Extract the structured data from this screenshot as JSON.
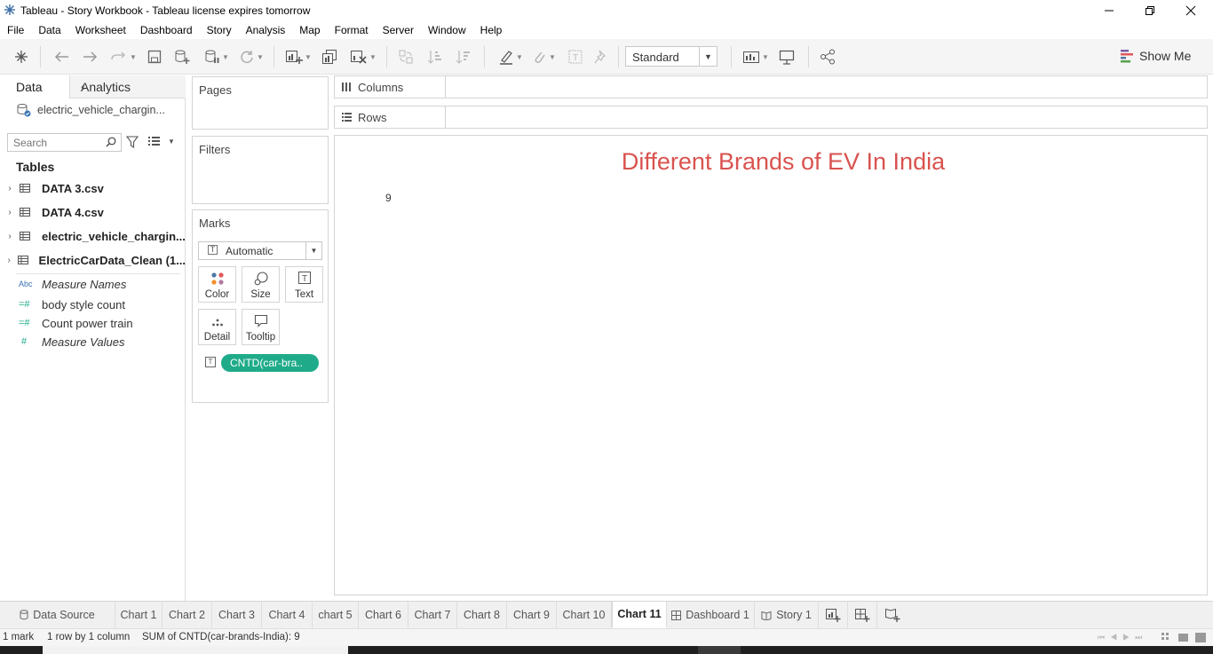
{
  "window": {
    "title": "Tableau - Story Workbook - Tableau license expires tomorrow"
  },
  "menu": [
    "File",
    "Data",
    "Worksheet",
    "Dashboard",
    "Story",
    "Analysis",
    "Map",
    "Format",
    "Server",
    "Window",
    "Help"
  ],
  "toolbar": {
    "fit_value": "Standard",
    "show_me_label": "Show Me"
  },
  "data_pane": {
    "tabs": {
      "data": "Data",
      "analytics": "Analytics"
    },
    "datasource": "electric_vehicle_chargin...",
    "search_placeholder": "Search",
    "tables_heading": "Tables",
    "tables": [
      {
        "label": "DATA 3.csv"
      },
      {
        "label": "DATA 4.csv"
      },
      {
        "label": "electric_vehicle_chargin..."
      },
      {
        "label": "ElectricCarData_Clean (1..."
      }
    ],
    "fields": [
      {
        "label": "Measure Names",
        "icon": "Abc",
        "italic": true
      },
      {
        "label": "body style count",
        "icon": "=#"
      },
      {
        "label": "Count power  train",
        "icon": "=#"
      },
      {
        "label": "Measure Values",
        "icon": "#",
        "italic": true
      }
    ]
  },
  "cards": {
    "pages": "Pages",
    "filters": "Filters",
    "marks": "Marks",
    "mark_type": "Automatic",
    "mark_buttons": {
      "color": "Color",
      "size": "Size",
      "text": "Text",
      "detail": "Detail",
      "tooltip": "Tooltip"
    },
    "pill": "CNTD(car-bra.."
  },
  "shelves": {
    "columns": "Columns",
    "rows": "Rows"
  },
  "view": {
    "title": "Different  Brands of EV In India",
    "value": "9",
    "title_color": "#d9534f"
  },
  "sheet_tabs": {
    "data_source": "Data Source",
    "sheets": [
      "Chart 1",
      "Chart 2",
      "Chart 3",
      "Chart 4",
      "chart 5",
      "Chart 6",
      "Chart 7",
      "Chart 8",
      "Chart 9",
      "Chart 10",
      "Chart 11"
    ],
    "active": "Chart 11",
    "dashboard": "Dashboard 1",
    "story": "Story 1"
  },
  "status": {
    "marks": "1 mark",
    "dims": "1 row by 1 column",
    "sum": "SUM of CNTD(car-brands-India): 9"
  },
  "colors": {
    "accent_pill": "#1fab89",
    "title_red": "#d9534f"
  }
}
